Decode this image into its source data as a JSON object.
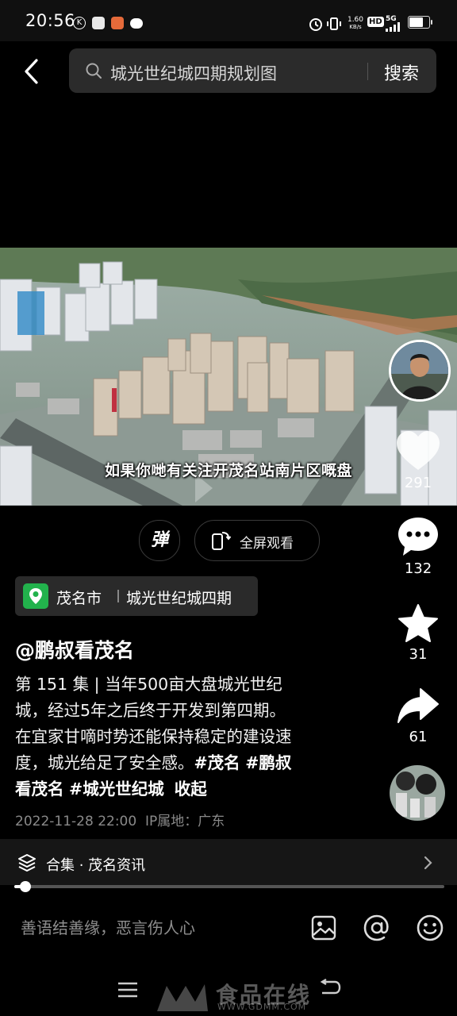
{
  "status_bar": {
    "time": "20:56",
    "network_speed": "1.60",
    "network_unit": "KB/s",
    "hd": "HD",
    "signal": "5G",
    "battery_level": 0.75
  },
  "search": {
    "query": "城光世纪城四期规划图",
    "button_label": "搜索"
  },
  "video": {
    "subtitle": "如果你哋有关注开茂名站南片区嘅盘"
  },
  "controls": {
    "danmaku_label": "弹",
    "fullscreen_label": "全屏观看"
  },
  "actions": {
    "likes": "291",
    "comments": "132",
    "favorites": "31",
    "shares": "61"
  },
  "location": {
    "city": "茂名市",
    "place": "城光世纪城四期"
  },
  "author": "@鹏叔看茂名",
  "description": {
    "line1": "第 151 集 | 当年500亩大盘城光世纪",
    "line2": "城，经过5年之后终于开发到第四期。",
    "line3": "在宜家甘嘀时势还能保持稳定的建设速",
    "line4_text": "度，城光给足了安全感。",
    "tag1": "#茂名",
    "tag2": "#鹏叔",
    "line5_tag2_rest": "看茂名",
    "tag3": "#城光世纪城",
    "collapse": "收起"
  },
  "meta": {
    "datetime": "2022-11-28 22:00",
    "ip_location": "IP属地：广东"
  },
  "collection": {
    "label": "合集 · 茂名资讯",
    "progress": 0.025
  },
  "comment": {
    "placeholder": "善语结善缘，恶言伤人心"
  },
  "watermark": {
    "text": "食品在线",
    "url": "WWW.GDMM.COM"
  }
}
